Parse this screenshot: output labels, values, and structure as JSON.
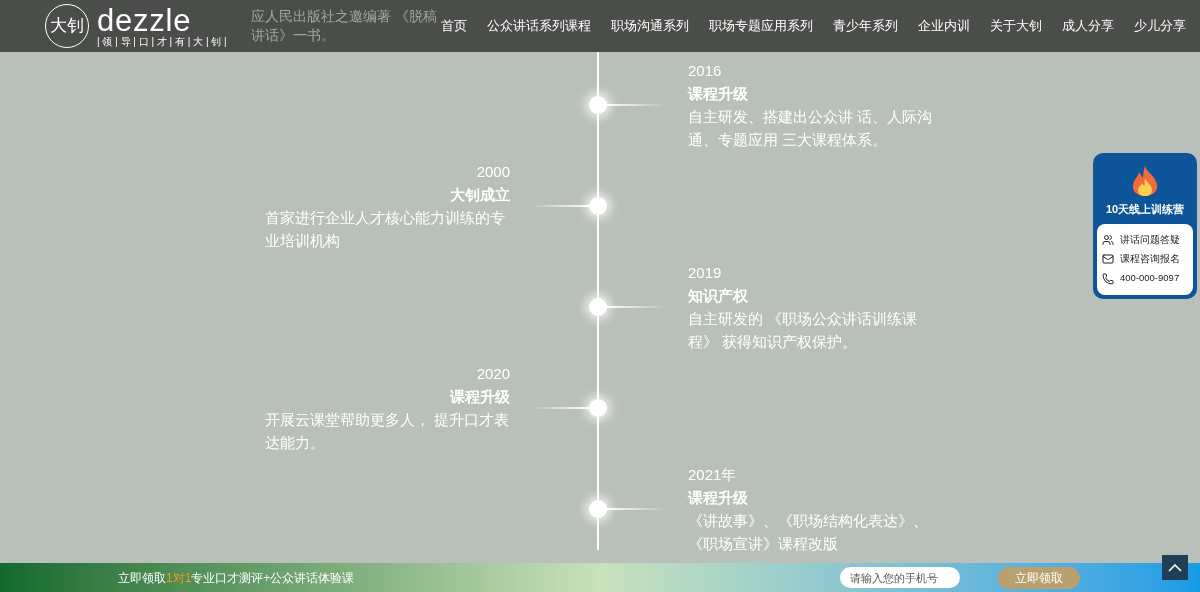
{
  "header": {
    "logo": {
      "mark": "大钊",
      "wordmark": "dezzle",
      "tagline": "| 领 | 导 | 口 | 才 | 有 | 大 | 钊 |"
    },
    "nav": [
      "首页",
      "公众讲话系列课程",
      "职场沟通系列",
      "职场专题应用系列",
      "青少年系列",
      "企业内训",
      "关于大钊",
      "成人分享",
      "少儿分享"
    ]
  },
  "timeline": {
    "partial_entry": "应人民出版社之邀编著 《脱稿讲话》一书。",
    "entries": [
      {
        "kind": "right",
        "year": "2016",
        "title": "课程升级",
        "text": "自主研发、搭建出公众讲 话、人际沟通、专题应用 三大课程体系。"
      },
      {
        "kind": "left",
        "year": "2000",
        "title": "大钊成立",
        "text": "首家进行企业人才核心能力训练的专业培训机构"
      },
      {
        "kind": "right",
        "year": "2019",
        "title": "知识产权",
        "text": "自主研发的 《职场公众讲话训练课程》 获得知识产权保护。"
      },
      {
        "kind": "left",
        "year": "2020",
        "title": "课程升级",
        "text": "开展云课堂帮助更多人， 提升口才表达能力。"
      },
      {
        "kind": "right",
        "year": "2021年",
        "title": "课程升级",
        "text": "《讲故事》、《职场结构化表达》、《职场宣讲》课程改版"
      }
    ]
  },
  "side_widget": {
    "title": "10天线上训练营",
    "links": [
      {
        "kind": "people",
        "label": "讲话问题答疑"
      },
      {
        "kind": "mail",
        "label": "课程咨询报名"
      },
      {
        "kind": "phone",
        "label": "400-000-9097"
      }
    ]
  },
  "promo_bar": {
    "text_before": "立即领取",
    "highlight": "1对1",
    "text_after": "专业口才测评+公众讲话体验课",
    "phone_field": {
      "placeholder": "请输入您的手机号"
    },
    "submit": "立即领取"
  }
}
